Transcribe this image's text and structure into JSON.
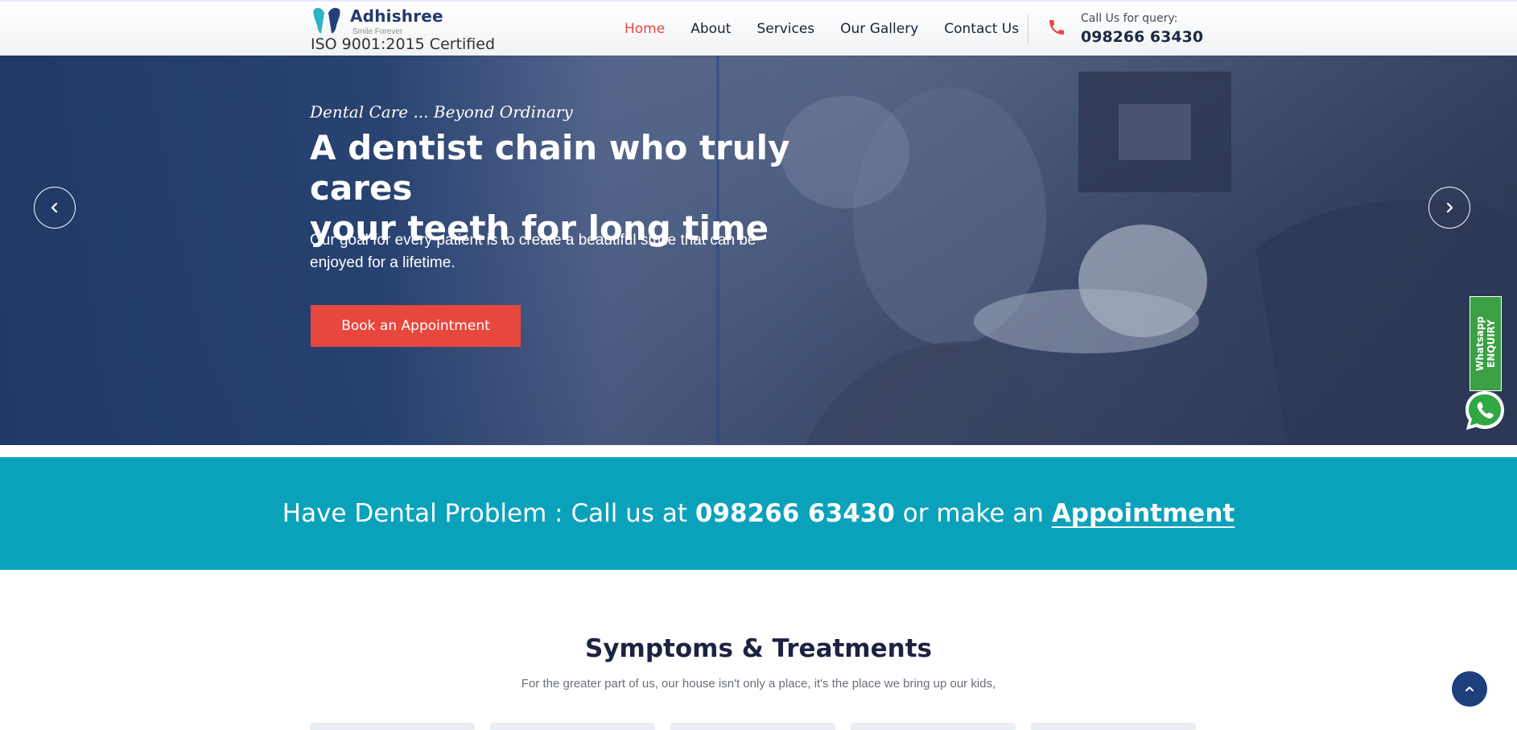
{
  "brand": {
    "name": "Adhishree",
    "tagline": "Smile Forever",
    "certification": "ISO 9001:2015 Certified",
    "accent": "#e8473d",
    "primary": "#1d3f7e",
    "teal": "#0aa2bb"
  },
  "nav": {
    "items": [
      {
        "label": "Home",
        "active": true
      },
      {
        "label": "About"
      },
      {
        "label": "Services"
      },
      {
        "label": "Our Gallery"
      },
      {
        "label": "Contact Us"
      }
    ]
  },
  "call": {
    "label": "Call Us for query:",
    "number": "098266 63430",
    "icon": "phone-icon"
  },
  "hero": {
    "eyebrow": "Dental Care ... Beyond Ordinary",
    "title_line1": "A dentist chain who truly cares",
    "title_line2": "your teeth for long time",
    "text": "Our goal for every patient is to create a beautiful smile that can be enjoyed for a lifetime.",
    "button": "Book an Appointment",
    "prev_icon": "chevron-left-icon",
    "next_icon": "chevron-right-icon"
  },
  "whatsapp": {
    "line1": "Whatsapp",
    "line2": "ENQUIRY",
    "icon": "whatsapp-icon"
  },
  "cta": {
    "prefix": "Have Dental Problem : Call us at",
    "number": "098266 63430",
    "middle": "or make an",
    "link": "Appointment"
  },
  "section": {
    "title": "Symptoms & Treatments",
    "subtitle": "For the greater part of us, our house isn't only a place, it's the place we bring up our kids,"
  },
  "back_to_top": {
    "icon": "chevron-up-icon"
  }
}
